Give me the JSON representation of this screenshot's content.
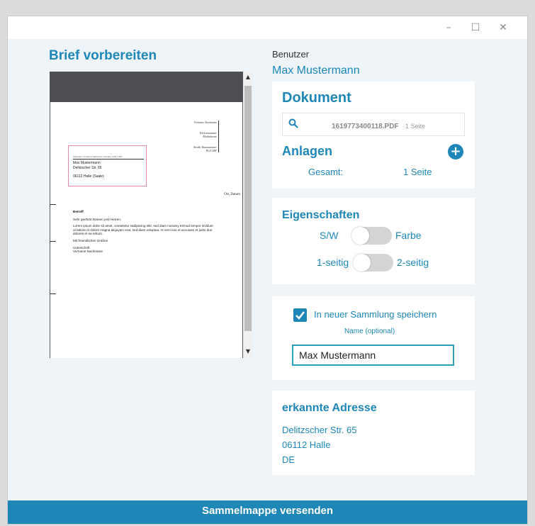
{
  "window": {
    "controls": {
      "minimize": "–",
      "maximize": "☐",
      "close": "✕"
    }
  },
  "page_title": "Brief vorbereiten",
  "preview": {
    "sender_name": "Vorname Nachname",
    "sender_phone": "Telefonnummer",
    "sender_mail": "Mailadresse",
    "sender_street": "Straße Hausnummer",
    "sender_city": "PLZ ORT",
    "return_address": "Absender: Vorname Nachname | Straße | PLZ | ORT",
    "recipient_name": "Max Mustermann",
    "recipient_street": "Delitzscher Str. 65",
    "recipient_city": "06112 Halle (Saale)",
    "place_date": "Ort, Datum",
    "subject": "Betreff",
    "salutation": "Sehr geehrte Damen und Herren,",
    "body": "Lorem ipsum dolor sit amet, consetetur sadipscing elitr, sed diam nonumy eirmod tempor invidunt ut labore et dolore magna aliquyam erat, sed diam voluptua. At vero eos et accusam et justo duo dolores et ea rebum.",
    "closing": "Mit freundlichen Grüßen",
    "signature_label": "Unterschrift",
    "signature_name": "Vorname Nachname"
  },
  "user": {
    "label": "Benutzer",
    "name": "Max Mustermann"
  },
  "document": {
    "heading": "Dokument",
    "file_name": "1619773400118.PDF",
    "file_pages": "1 Seite",
    "attachments_heading": "Anlagen",
    "total_label": "Gesamt:",
    "total_value": "1 Seite"
  },
  "properties": {
    "heading": "Eigenschaften",
    "color_left": "S/W",
    "color_right": "Farbe",
    "color_value": "S/W",
    "sides_left": "1-seitig",
    "sides_right": "2-seitig",
    "sides_value": "1-seitig"
  },
  "collection": {
    "checkbox_label": "In neuer Sammlung speichern",
    "checked": true,
    "name_label": "Name (optional)",
    "name_value": "Max Mustermann"
  },
  "address": {
    "heading": "erkannte Adresse",
    "street": "Delitzscher Str. 65",
    "city": "06112 Halle",
    "country": "DE"
  },
  "footer": {
    "send_label": "Sammelmappe versenden"
  },
  "colors": {
    "accent": "#1e87b7",
    "background": "#eef4f7",
    "toggle_track": "#d4d4d4"
  },
  "icons": [
    "search-icon",
    "plus-icon",
    "check-icon",
    "minimize-icon",
    "maximize-icon",
    "close-icon"
  ]
}
